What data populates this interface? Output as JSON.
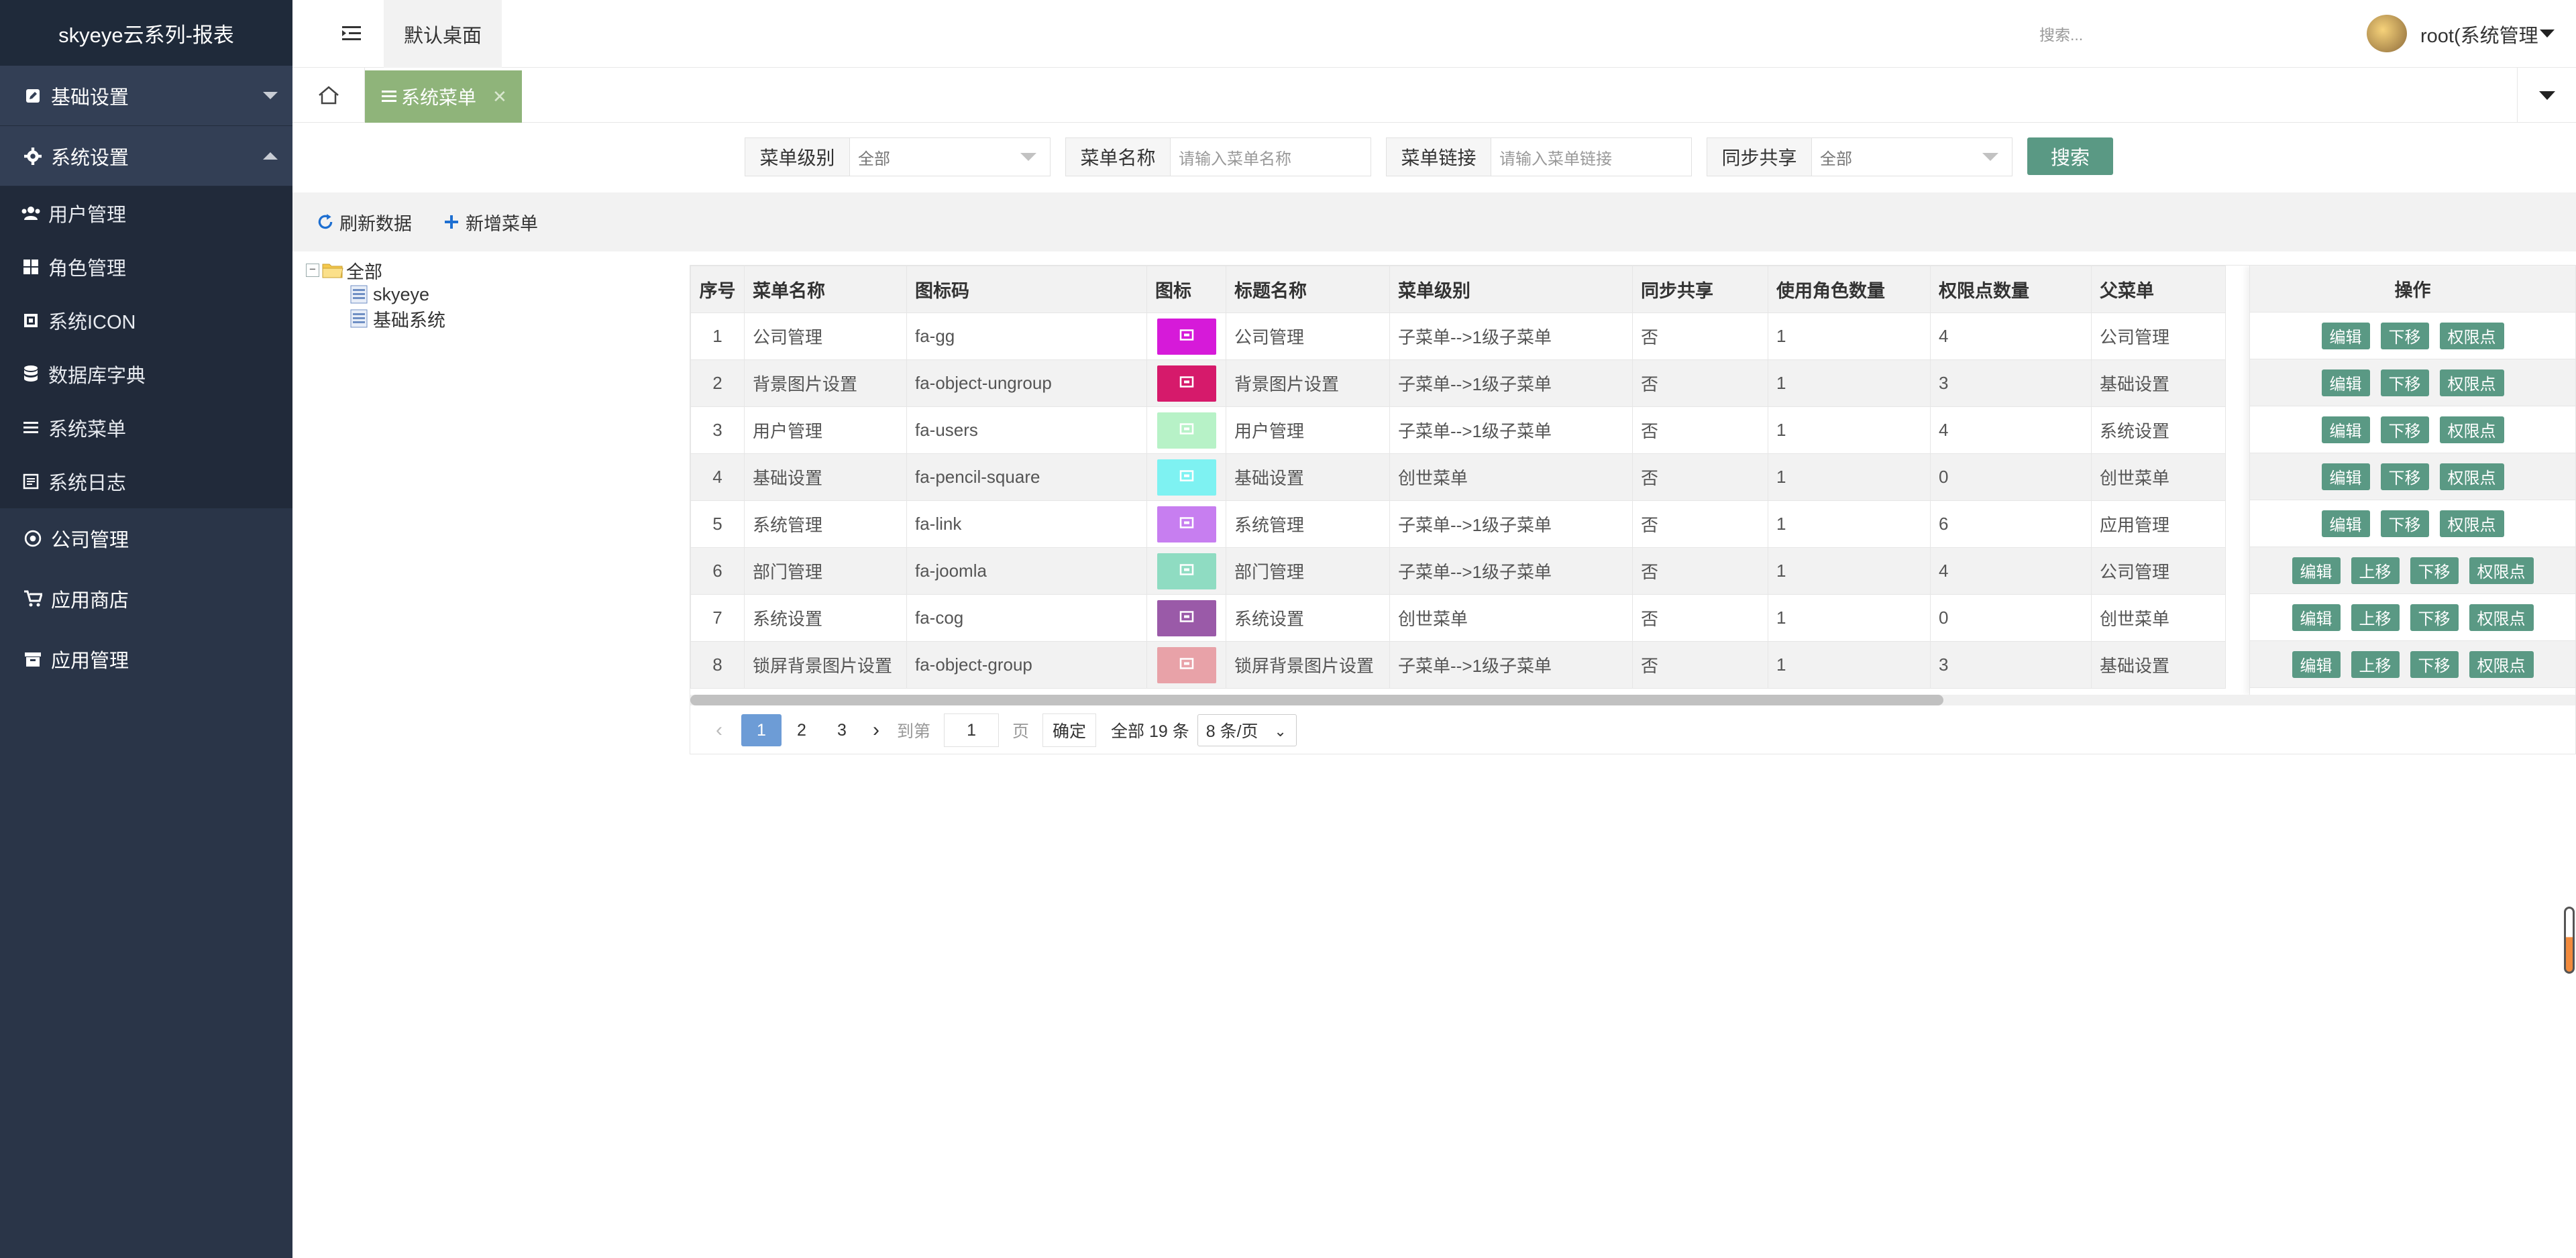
{
  "sidebar": {
    "brand": "skyeye云系列-报表",
    "groups": [
      {
        "label": "基础设置",
        "icon": "pencil-square-icon",
        "expanded": false
      },
      {
        "label": "系统设置",
        "icon": "cog-icon",
        "expanded": true,
        "items": [
          {
            "label": "用户管理",
            "icon": "users-icon"
          },
          {
            "label": "角色管理",
            "icon": "th-large-icon"
          },
          {
            "label": "系统ICON",
            "icon": "icon-icon"
          },
          {
            "label": "数据库字典",
            "icon": "database-icon"
          },
          {
            "label": "系统菜单",
            "icon": "bars-icon"
          },
          {
            "label": "系统日志",
            "icon": "log-icon"
          }
        ]
      },
      {
        "label": "公司管理",
        "icon": "company-icon",
        "expanded": false
      },
      {
        "label": "应用商店",
        "icon": "cart-icon",
        "expanded": false
      },
      {
        "label": "应用管理",
        "icon": "archive-icon",
        "expanded": false
      }
    ]
  },
  "header": {
    "desk_tab": "默认桌面",
    "search_placeholder": "搜索...",
    "user": "root(系统管理"
  },
  "tabbar": {
    "active_tab": "系统菜单",
    "close_glyph": "✕"
  },
  "filters": [
    {
      "label": "菜单级别",
      "value": "全部",
      "type": "select"
    },
    {
      "label": "菜单名称",
      "placeholder": "请输入菜单名称",
      "type": "input"
    },
    {
      "label": "菜单链接",
      "placeholder": "请输入菜单链接",
      "type": "input"
    },
    {
      "label": "同步共享",
      "value": "全部",
      "type": "select"
    }
  ],
  "search_button": "搜索",
  "toolbar": {
    "refresh": "刷新数据",
    "add": "新增菜单"
  },
  "tree": {
    "root": "全部",
    "children": [
      "skyeye",
      "基础系统"
    ]
  },
  "table": {
    "headers": [
      "序号",
      "菜单名称",
      "图标码",
      "图标",
      "标题名称",
      "菜单级别",
      "同步共享",
      "使用角色数量",
      "权限点数量",
      "父菜单"
    ],
    "ops_header": "操作",
    "rows": [
      {
        "no": "1",
        "name": "公司管理",
        "code": "fa-gg",
        "color": "#d61ad9",
        "title": "公司管理",
        "level": "子菜单-->1级子菜单",
        "share": "否",
        "roles": "1",
        "perms": "4",
        "parent": "公司管理",
        "ops": [
          "编辑",
          "下移",
          "权限点"
        ]
      },
      {
        "no": "2",
        "name": "背景图片设置",
        "code": "fa-object-ungroup",
        "color": "#d61a6b",
        "title": "背景图片设置",
        "level": "子菜单-->1级子菜单",
        "share": "否",
        "roles": "1",
        "perms": "3",
        "parent": "基础设置",
        "ops": [
          "编辑",
          "下移",
          "权限点"
        ]
      },
      {
        "no": "3",
        "name": "用户管理",
        "code": "fa-users",
        "color": "#b7f2c7",
        "title": "用户管理",
        "level": "子菜单-->1级子菜单",
        "share": "否",
        "roles": "1",
        "perms": "4",
        "parent": "系统设置",
        "ops": [
          "编辑",
          "下移",
          "权限点"
        ]
      },
      {
        "no": "4",
        "name": "基础设置",
        "code": "fa-pencil-square",
        "color": "#7ef2f2",
        "title": "基础设置",
        "level": "创世菜单",
        "share": "否",
        "roles": "1",
        "perms": "0",
        "parent": "创世菜单",
        "ops": [
          "编辑",
          "下移",
          "权限点"
        ]
      },
      {
        "no": "5",
        "name": "系统管理",
        "code": "fa-link",
        "color": "#c77ef0",
        "title": "系统管理",
        "level": "子菜单-->1级子菜单",
        "share": "否",
        "roles": "1",
        "perms": "6",
        "parent": "应用管理",
        "ops": [
          "编辑",
          "下移",
          "权限点"
        ]
      },
      {
        "no": "6",
        "name": "部门管理",
        "code": "fa-joomla",
        "color": "#8fdcc2",
        "title": "部门管理",
        "level": "子菜单-->1级子菜单",
        "share": "否",
        "roles": "1",
        "perms": "4",
        "parent": "公司管理",
        "ops": [
          "编辑",
          "上移",
          "下移",
          "权限点"
        ]
      },
      {
        "no": "7",
        "name": "系统设置",
        "code": "fa-cog",
        "color": "#9a5aa8",
        "title": "系统设置",
        "level": "创世菜单",
        "share": "否",
        "roles": "1",
        "perms": "0",
        "parent": "创世菜单",
        "ops": [
          "编辑",
          "上移",
          "下移",
          "权限点"
        ]
      },
      {
        "no": "8",
        "name": "锁屏背景图片设置",
        "code": "fa-object-group",
        "color": "#e8a2a8",
        "title": "锁屏背景图片设置",
        "level": "子菜单-->1级子菜单",
        "share": "否",
        "roles": "1",
        "perms": "3",
        "parent": "基础设置",
        "ops": [
          "编辑",
          "上移",
          "下移",
          "权限点"
        ]
      }
    ]
  },
  "pager": {
    "pages": [
      "1",
      "2",
      "3"
    ],
    "current": "1",
    "goto_label": "到第",
    "goto_value": "1",
    "page_unit": "页",
    "confirm": "确定",
    "total": "全部 19 条",
    "page_size": "8 条/页"
  }
}
